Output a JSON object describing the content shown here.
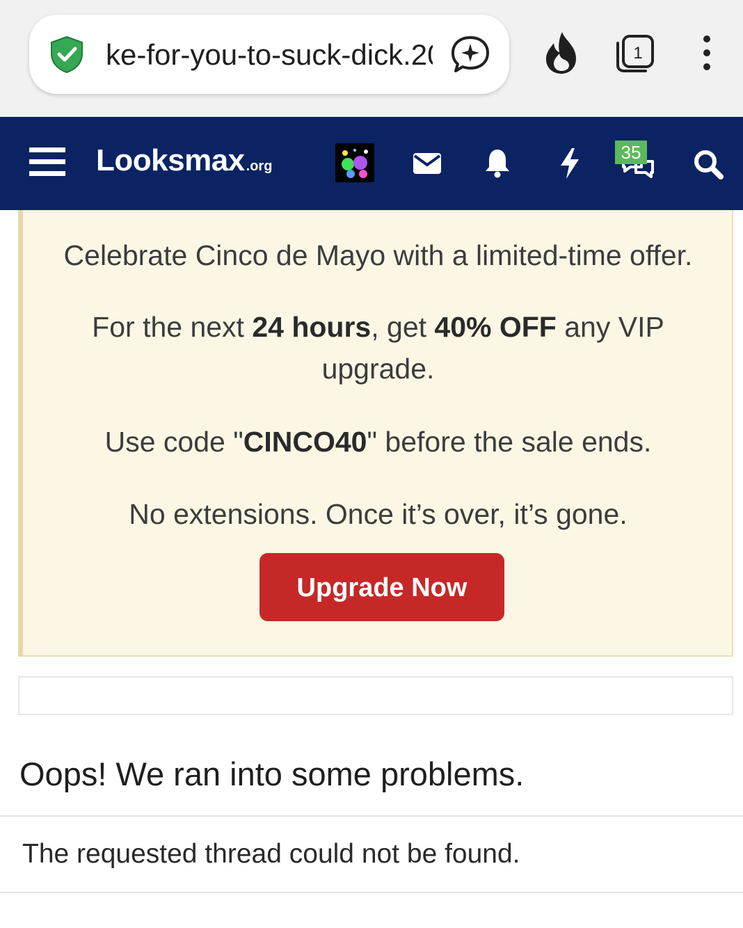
{
  "browser": {
    "url_text": "ke-for-you-to-suck-dick.20",
    "tab_count": "1",
    "icons": [
      "shield-check-icon",
      "assistant-sparkle-icon",
      "flame-icon",
      "tabs-icon",
      "more-vert-icon"
    ]
  },
  "header": {
    "logo_main": "Looksmax",
    "logo_tld": ".org",
    "conversations_badge": "35",
    "icons": [
      "menu-icon",
      "avatar",
      "mail-icon",
      "bell-icon",
      "bolt-icon",
      "chat-icon",
      "search-icon"
    ],
    "background_color": "#0b2363"
  },
  "notice": {
    "line1": "Celebrate Cinco de Mayo with a limited-time offer.",
    "line2_a": "For the next ",
    "line2_hours": "24 hours",
    "line2_b": ", get ",
    "line2_off": "40% OFF",
    "line2_c": " any VIP upgrade.",
    "line3_a": "Use code \"",
    "line3_code": "CINCO40",
    "line3_b": "\" before the sale ends.",
    "line4": "No extensions. Once it’s over, it’s gone.",
    "button_label": "Upgrade Now",
    "button_color": "#c62828",
    "background_color": "#fcf7e5"
  },
  "error": {
    "title": "Oops! We ran into some problems.",
    "message": "The requested thread could not be found."
  }
}
